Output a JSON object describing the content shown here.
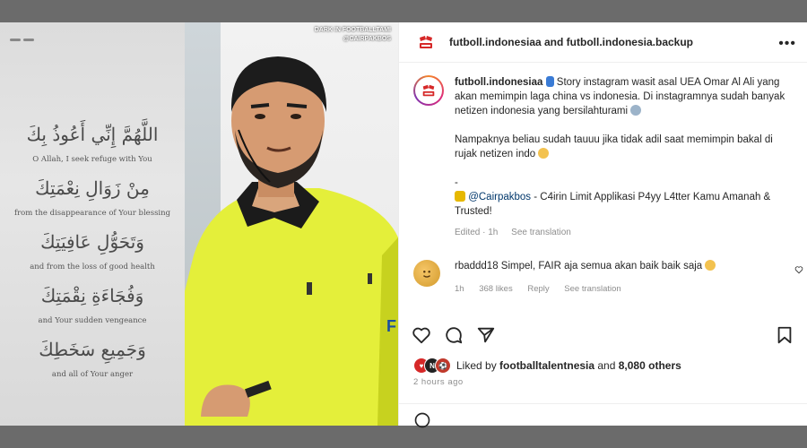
{
  "story": {
    "duas": [
      {
        "arabic": "اللَّهُمَّ إِنِّي أَعُوذُ بِكَ",
        "english": "O Allah, I seek refuge with You"
      },
      {
        "arabic": "مِنْ زَوَالِ نِعْمَتِكَ",
        "english": "from the disappearance of Your blessing"
      },
      {
        "arabic": "وَتَحَوُّلِ عَافِيَتِكَ",
        "english": "and from the loss of good health"
      },
      {
        "arabic": "وَفُجَاءَةِ نِقْمَتِكَ",
        "english": "and Your sudden vengeance"
      },
      {
        "arabic": "وَجَمِيعِ سَخَطِكَ",
        "english": "and all of Your anger"
      }
    ]
  },
  "photo": {
    "watermark_line1": "DARK IN FOOTBALLTAMI",
    "watermark_line2": "@CAIRPAKBOS"
  },
  "post": {
    "header_accounts": "futboll.indonesiaa and futboll.indonesia.backup",
    "more_icon": "more-dots-icon",
    "caption": {
      "username": "futboll.indonesiaa",
      "p1": "Story instagram wasit asal UEA Omar Al Ali yang akan memimpin laga china vs indonesia. Di instagramnya sudah banyak netizen indonesia yang bersilahturami",
      "p2": "Nampaknya beliau sudah tauuu jika tidak adil saat memimpin bakal di rujak netizen indo",
      "dash": "-",
      "promo_handle": "@Cairpakbos",
      "promo_text": " - C4irin Limit Applikasi P4yy L4tter Kamu Amanah & Trusted!",
      "edited": "Edited · 1h",
      "see_translation": "See translation"
    },
    "comment": {
      "username": "rbaddd18",
      "text": " Simpel, FAIR aja semua akan baik baik saja",
      "time": "1h",
      "likes": "368 likes",
      "reply": "Reply",
      "see_translation": "See translation"
    },
    "likes": {
      "prefix": "Liked by ",
      "user": "footballtalentnesia",
      "middle": " and ",
      "count": "8,080 others"
    },
    "time_ago": "2 hours ago"
  },
  "colors": {
    "ig_gradient": [
      "#f58529",
      "#dd2a7b",
      "#8134af"
    ],
    "brand_red": "#d62828",
    "referee_yellow": "#e4ef3a"
  }
}
